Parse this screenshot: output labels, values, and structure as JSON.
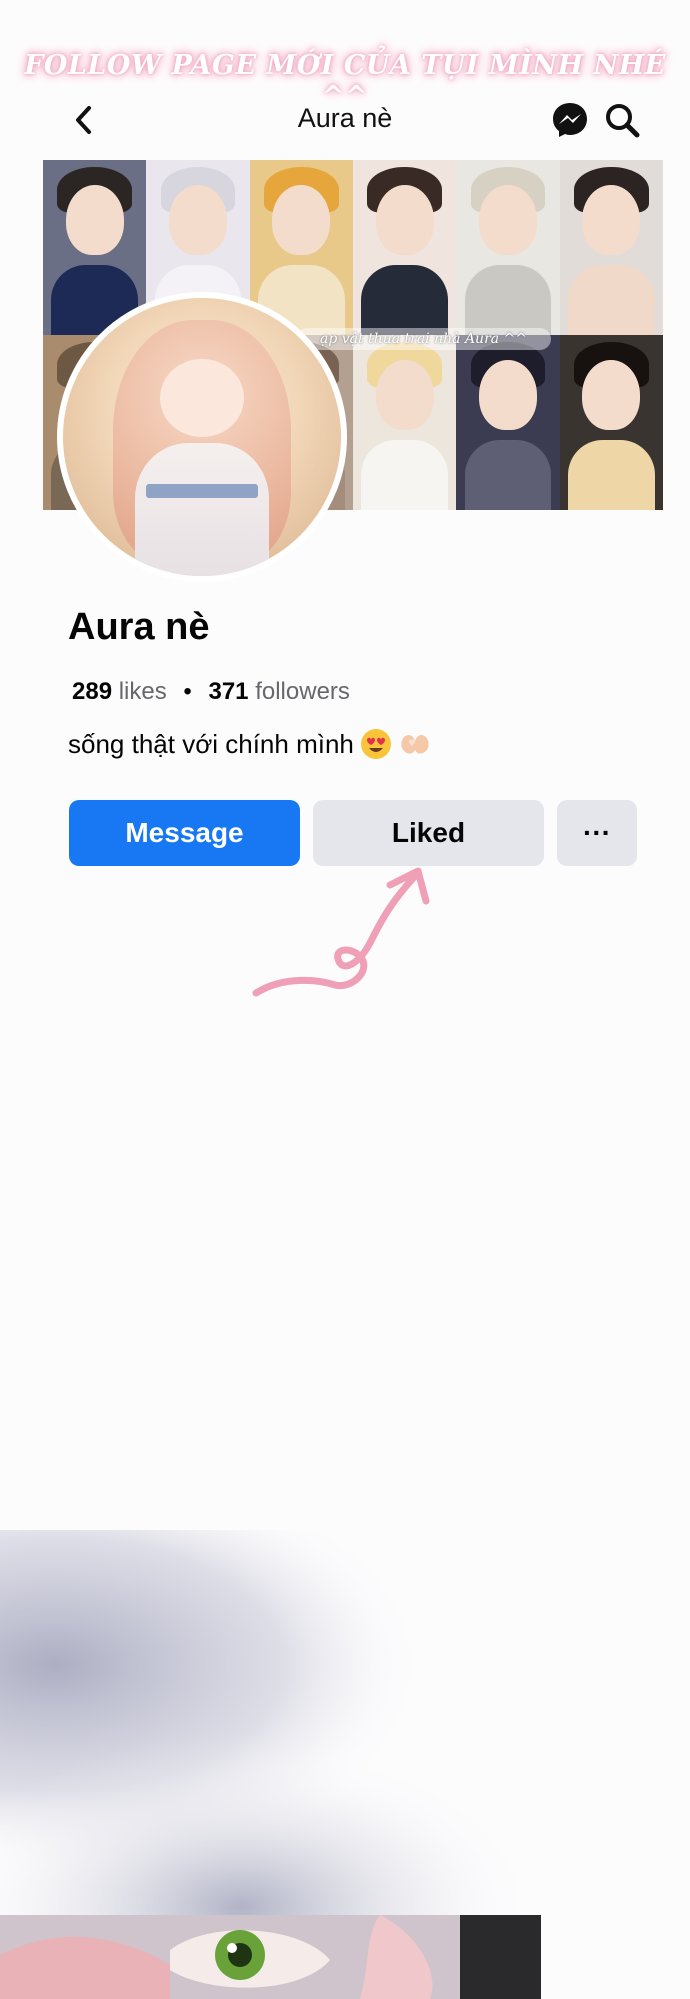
{
  "banner": "FOLLOW PAGE MỚI CỦA TỤI MÌNH NHÉ ^^",
  "header": {
    "title": "Aura nè",
    "icons": [
      "back-chevron-icon",
      "messenger-icon",
      "search-icon"
    ]
  },
  "cover": {
    "caption": "ạp vật thua trai nhà Aura ^^"
  },
  "profile": {
    "name": "Aura nè",
    "likes_count": "289",
    "likes_label": "likes",
    "followers_count": "371",
    "followers_label": "followers",
    "bio": "sống thật với chính mình"
  },
  "actions": {
    "message": "Message",
    "liked": "Liked",
    "more": "···"
  },
  "colors": {
    "primary": "#1877f2",
    "secondary_button": "#e4e6eb",
    "banner_glow": "#f2a9c0",
    "arrow": "#ef9fb6"
  }
}
